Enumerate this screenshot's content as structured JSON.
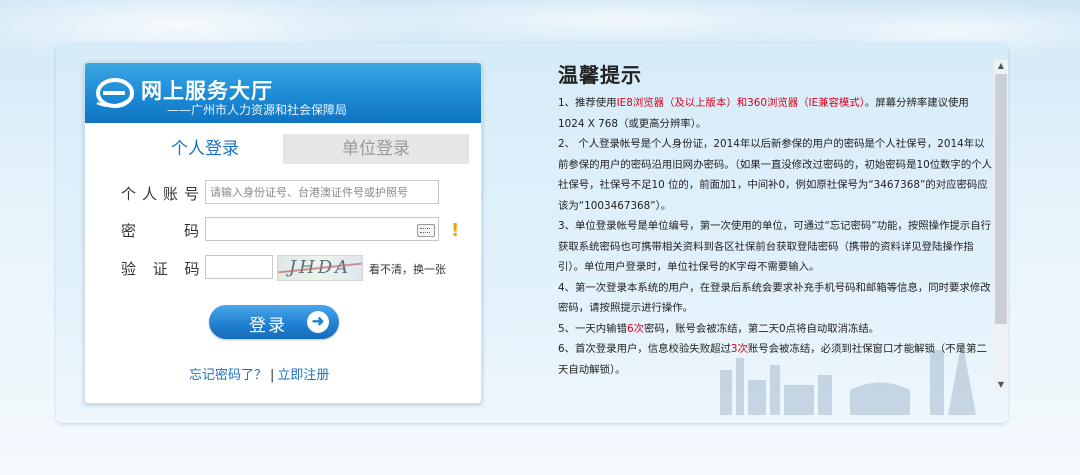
{
  "header": {
    "logo_title": "网上服务大厅",
    "logo_subtitle": "——广州市人力资源和社会保障局"
  },
  "tabs": [
    {
      "label": "个人登录",
      "active": true
    },
    {
      "label": "单位登录",
      "active": false
    }
  ],
  "form": {
    "account_label": "个人账号：",
    "account_placeholder": "请输入身份证号、台港澳证件号或护照号",
    "password_label": "密　　码：",
    "captcha_label": "验 证 码：",
    "captcha_text": "JHDA",
    "refresh_label": "看不清，换一张",
    "login_button": "登录",
    "forgot_password": "忘记密码了？",
    "separator": "|",
    "register": "立即注册"
  },
  "tips": {
    "title": "温馨提示",
    "items": [
      {
        "pre": "1、推荐使用",
        "red": "IE8浏览器（及以上版本）和360浏览器（IE兼容模式）",
        "post": "。屏幕分辨率建议使用1024 X 768（或更高分辨率）。"
      },
      {
        "pre": "2、 个人登录帐号是个人身份证，2014年以后新参保的用户的密码是个人社保号，2014年以前参保的用户的密码沿用旧网办密码。（如果一直没修改过密码的，初始密码是10位数字的个人社保号，社保号不足10 位的，前面加1，中间补0，例如原社保号为“3467368”的对应密码应该为“1003467368”）。",
        "red": "",
        "post": ""
      },
      {
        "pre": "3、单位登录帐号是单位编号，第一次使用的单位，可通过“忘记密码”功能，按照操作提示自行获取系统密码也可携带相关资料到各区社保前台获取登陆密码（携带的资料详见登陆操作指引）。单位用户登录时，单位社保号的K字母不需要输入。",
        "red": "",
        "post": ""
      },
      {
        "pre": "4、第一次登录本系统的用户，在登录后系统会要求补充手机号码和邮箱等信息，同时要求修改密码，请按照提示进行操作。",
        "red": "",
        "post": ""
      },
      {
        "pre": "5、一天内输错",
        "red": "6次",
        "post": "密码，账号会被冻结，第二天0点将自动取消冻结。"
      },
      {
        "pre": "6、首次登录用户，信息校验失败超过",
        "red": "3次",
        "post": "账号会被冻结，必须到社保窗口才能解锁（不是第二天自动解锁）。"
      }
    ]
  }
}
